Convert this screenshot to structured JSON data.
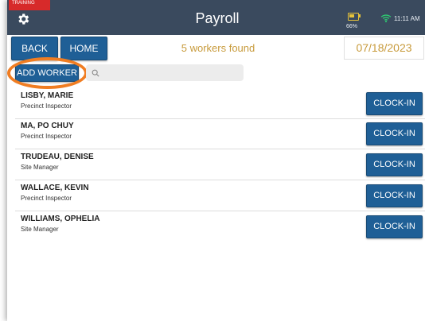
{
  "header": {
    "training_badge": "TRAINING",
    "title": "Payroll",
    "battery_percent": "66%",
    "time": "11:11 AM"
  },
  "toolbar": {
    "back_label": "BACK",
    "home_label": "HOME",
    "workers_found": "5 workers found",
    "date": "07/18/2023",
    "add_worker_label": "ADD WORKER",
    "search_placeholder": ""
  },
  "workers": [
    {
      "name": "LISBY, MARIE",
      "role": "Precinct Inspector",
      "action": "CLOCK-IN"
    },
    {
      "name": "MA, PO CHUY",
      "role": "Precinct Inspector",
      "action": "CLOCK-IN"
    },
    {
      "name": "TRUDEAU, DENISE",
      "role": "Site Manager",
      "action": "CLOCK-IN"
    },
    {
      "name": "WALLACE, KEVIN",
      "role": "Precinct Inspector",
      "action": "CLOCK-IN"
    },
    {
      "name": "WILLIAMS, OPHELIA",
      "role": "Site Manager",
      "action": "CLOCK-IN"
    }
  ],
  "colors": {
    "header_bg": "#3a4a5e",
    "button_bg": "#1f5f96",
    "accent_text": "#c89b3c",
    "highlight_oval": "#f07d22",
    "training_badge": "#d72a2a"
  },
  "icons": {
    "settings": "gear-icon",
    "battery": "battery-icon",
    "wifi": "wifi-icon",
    "search": "search-icon"
  }
}
